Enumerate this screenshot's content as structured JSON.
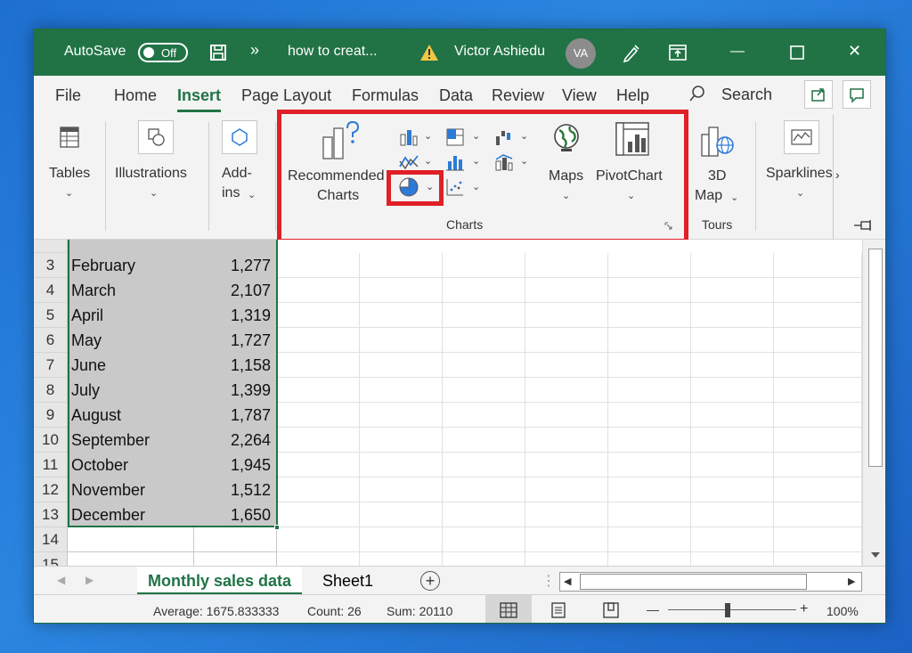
{
  "titlebar": {
    "autosave_label": "AutoSave",
    "autosave_state": "Off",
    "nav_more": "»",
    "doc_title": "how to creat...",
    "user_name": "Victor Ashiedu",
    "user_initials": "VA",
    "minimize_glyph": "—",
    "close_glyph": "✕"
  },
  "menu": {
    "tabs": [
      "File",
      "Home",
      "Insert",
      "Page Layout",
      "Formulas",
      "Data",
      "Review",
      "View",
      "Help"
    ],
    "active_tab": "Insert",
    "search_label": "Search"
  },
  "ribbon": {
    "tables_label": "Tables",
    "illustrations_label": "Illustrations",
    "addins_label_1": "Add-",
    "addins_label_2": "ins",
    "recommended_label_1": "Recommended",
    "recommended_label_2": "Charts",
    "maps_label": "Maps",
    "pivotchart_label": "PivotChart",
    "map3d_label_1": "3D",
    "map3d_label_2": "Map",
    "sparklines_label": "Sparklines",
    "charts_group_label": "Charts",
    "tours_group_label": "Tours",
    "chev": "⌄",
    "more_chev": "›"
  },
  "grid": {
    "rows": [
      {
        "num": "3",
        "month": "February",
        "value": "1,277"
      },
      {
        "num": "4",
        "month": "March",
        "value": "2,107"
      },
      {
        "num": "5",
        "month": "April",
        "value": "1,319"
      },
      {
        "num": "6",
        "month": "May",
        "value": "1,727"
      },
      {
        "num": "7",
        "month": "June",
        "value": "1,158"
      },
      {
        "num": "8",
        "month": "July",
        "value": "1,399"
      },
      {
        "num": "9",
        "month": "August",
        "value": "1,787"
      },
      {
        "num": "10",
        "month": "September",
        "value": "2,264"
      },
      {
        "num": "11",
        "month": "October",
        "value": "1,945"
      },
      {
        "num": "12",
        "month": "November",
        "value": "1,512"
      },
      {
        "num": "13",
        "month": "December",
        "value": "1,650"
      }
    ],
    "empty_rows": [
      "14",
      "15"
    ]
  },
  "sheets": {
    "tabs": [
      "Monthly sales data",
      "Sheet1"
    ],
    "active": "Monthly sales data",
    "add_glyph": "+"
  },
  "status": {
    "average": "Average: 1675.833333",
    "count": "Count: 26",
    "sum": "Sum: 20110",
    "zoom_minus": "—",
    "zoom_plus": "+",
    "zoom": "100%"
  },
  "colors": {
    "excel_green": "#217346",
    "highlight_red": "#e01f26",
    "selection_gray": "#c9c9c9"
  }
}
